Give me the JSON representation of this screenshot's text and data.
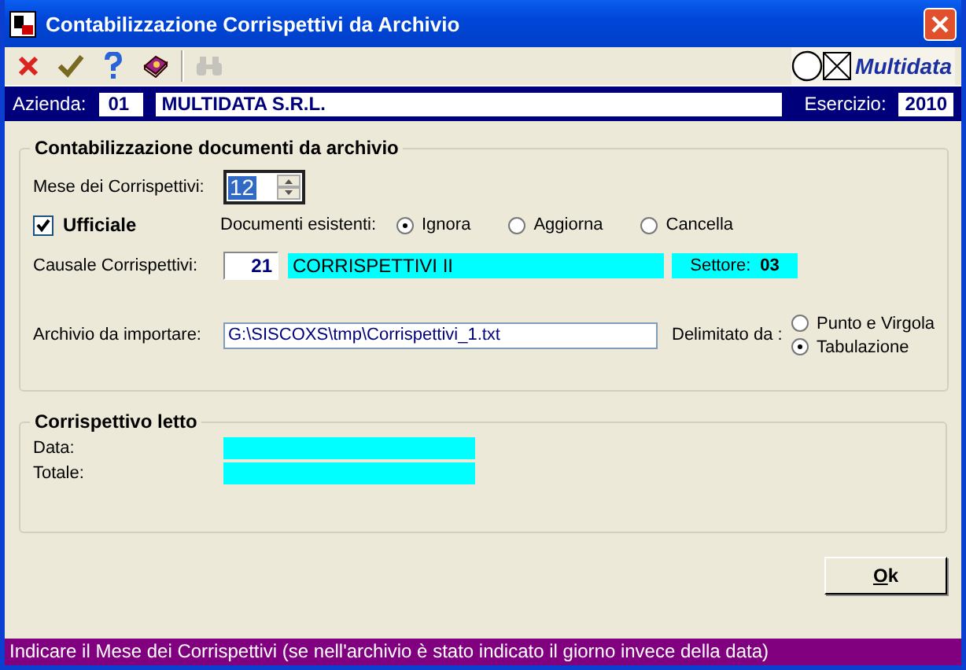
{
  "window": {
    "title": "Contabilizzazione Corrispettivi da Archivio"
  },
  "toolbar": [
    {
      "kind": "cancel",
      "disabled": false
    },
    {
      "kind": "confirm",
      "disabled": false
    },
    {
      "kind": "help",
      "disabled": false
    },
    {
      "kind": "book",
      "disabled": false
    },
    {
      "kind": "find",
      "disabled": true
    }
  ],
  "brand": "Multidata",
  "header": {
    "azienda_label": "Azienda:",
    "azienda_code": "01",
    "azienda_name": "MULTIDATA S.R.L.",
    "esercizio_label": "Esercizio:",
    "esercizio": "2010"
  },
  "section1": {
    "title": "Contabilizzazione documenti da archivio",
    "mese_label": "Mese dei Corrispettivi:",
    "mese_value": "12",
    "ufficiale": {
      "label": "Ufficiale",
      "checked": true
    },
    "documenti_label": "Documenti esistenti:",
    "documenti_options": [
      {
        "label": "Ignora",
        "selected": true
      },
      {
        "label": "Aggiorna",
        "selected": false
      },
      {
        "label": "Cancella",
        "selected": false
      }
    ],
    "causale_label": "Causale Corrispettivi:",
    "causale_code": "21",
    "causale_name": "CORRISPETTIVI II",
    "settore_label": "Settore:",
    "settore": "03",
    "archivio_label": "Archivio da importare:",
    "archivio_value": "G:\\SISCOXS\\tmp\\Corrispettivi_1.txt",
    "delimitato_label": "Delimitato da :",
    "delimitato_options": [
      {
        "label": "Punto e Virgola",
        "selected": false
      },
      {
        "label": "Tabulazione",
        "selected": true
      }
    ]
  },
  "section2": {
    "title": "Corrispettivo letto",
    "fields": [
      {
        "label": "Data:"
      },
      {
        "label": "Totale:"
      }
    ]
  },
  "ok_button": "Ok",
  "status": "Indicare il Mese dei Corrispettivi (se nell'archivio è stato indicato il giorno invece della data)"
}
